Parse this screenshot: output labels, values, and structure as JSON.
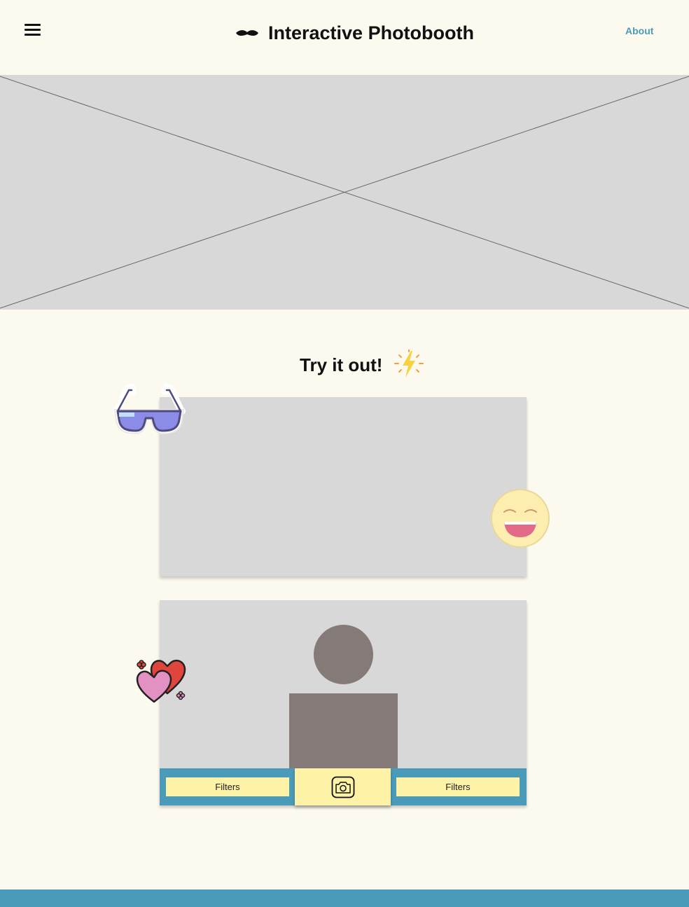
{
  "header": {
    "menu_icon": "hamburger-menu-icon",
    "logo_icon": "mustache-icon",
    "title": "Interactive Photobooth",
    "about_label": "About"
  },
  "hero": {
    "type": "image-placeholder"
  },
  "try_section": {
    "heading": "Try it out!",
    "heading_icon": "lightning-bolt-icon"
  },
  "controls": {
    "filter_left_label": "Filters",
    "filter_right_label": "Filters",
    "shutter_icon": "camera-icon"
  },
  "stickers": [
    "sunglasses-sticker",
    "smiley-face-sticker",
    "hearts-sticker"
  ],
  "colors": {
    "background": "#fcf9ef",
    "accent": "#4a9bb9",
    "button": "#fdf2a5",
    "placeholder": "#d8d8d8",
    "silhouette": "#847a78"
  }
}
